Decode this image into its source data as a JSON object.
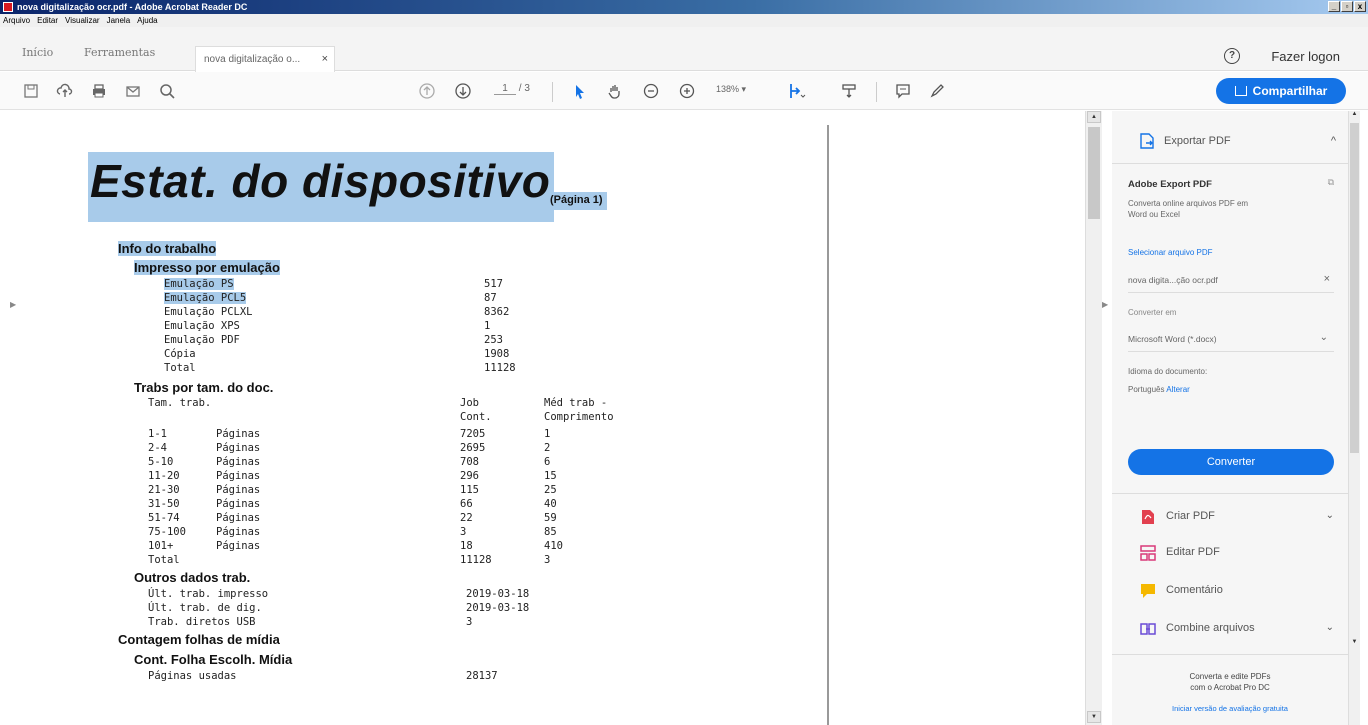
{
  "window": {
    "title": "nova digitalização ocr.pdf - Adobe Acrobat Reader DC",
    "controls": [
      "_",
      "▫",
      "x"
    ]
  },
  "menu": [
    "Arquivo",
    "Editar",
    "Visualizar",
    "Janela",
    "Ajuda"
  ],
  "tabs": {
    "home": "Início",
    "tools": "Ferramentas",
    "doc": "nova digitalização o...",
    "doc_close": "×"
  },
  "header": {
    "help": "?",
    "login": "Fazer logon"
  },
  "toolbar": {
    "page_current": "1",
    "page_total": "/ 3",
    "zoom": "138% ▾",
    "share": "Compartilhar"
  },
  "document": {
    "title": "Estat. do dispositivo",
    "title_sub": "(Página 1)",
    "s_info": "Info do trabalho",
    "s_emul": "Impresso por emulação",
    "emulation": [
      {
        "label": "Emulação PS",
        "value": "517"
      },
      {
        "label": "Emulação PCL5",
        "value": "87"
      },
      {
        "label": "Emulação PCLXL",
        "value": "8362"
      },
      {
        "label": "Emulação XPS",
        "value": "1"
      },
      {
        "label": "Emulação PDF",
        "value": "253"
      },
      {
        "label": "Cópia",
        "value": "1908"
      },
      {
        "label": "Total",
        "value": "11128"
      }
    ],
    "s_size": "Trabs por tam. do doc.",
    "size_head": {
      "c1": "Tam. trab.",
      "c2a": "Job",
      "c2b": "Cont.",
      "c3a": "Méd trab -",
      "c3b": "Comprimento"
    },
    "size_rows": [
      {
        "range": "1-1",
        "unit": "Páginas",
        "count": "7205",
        "avg": "1"
      },
      {
        "range": "2-4",
        "unit": "Páginas",
        "count": "2695",
        "avg": "2"
      },
      {
        "range": "5-10",
        "unit": "Páginas",
        "count": "708",
        "avg": "6"
      },
      {
        "range": "11-20",
        "unit": "Páginas",
        "count": "296",
        "avg": "15"
      },
      {
        "range": "21-30",
        "unit": "Páginas",
        "count": "115",
        "avg": "25"
      },
      {
        "range": "31-50",
        "unit": "Páginas",
        "count": "66",
        "avg": "40"
      },
      {
        "range": "51-74",
        "unit": "Páginas",
        "count": "22",
        "avg": "59"
      },
      {
        "range": "75-100",
        "unit": "Páginas",
        "count": "3",
        "avg": "85"
      },
      {
        "range": "101+",
        "unit": "Páginas",
        "count": "18",
        "avg": "410"
      },
      {
        "range": "Total",
        "unit": "",
        "count": "11128",
        "avg": "3"
      }
    ],
    "s_other": "Outros dados trab.",
    "other": [
      {
        "label": "Últ. trab. impresso",
        "value": "2019-03-18"
      },
      {
        "label": "Últ. trab. de dig.",
        "value": "2019-03-18"
      },
      {
        "label": "Trab. diretos USB",
        "value": "3"
      }
    ],
    "s_media": "Contagem folhas de mídia",
    "s_media_sub": "Cont. Folha Escolh. Mídia",
    "media": [
      {
        "label": "Páginas usadas",
        "value": "28137"
      }
    ]
  },
  "panel": {
    "export_title": "Exportar PDF",
    "export_caret": "^",
    "adobe_export": "Adobe Export PDF",
    "desc1": "Converta online arquivos PDF em",
    "desc2": "Word ou Excel",
    "select_file": "Selecionar arquivo PDF",
    "file_name": "nova digita...ção ocr.pdf",
    "file_remove": "×",
    "convert_to": "Converter em",
    "format": "Microsoft Word (*.docx)",
    "format_caret": "⌄",
    "lang_label": "Idioma do documento:",
    "lang_value": "Português",
    "lang_change": "Alterar",
    "convert_btn": "Converter",
    "tools": [
      {
        "label": "Criar PDF",
        "caret": "⌄"
      },
      {
        "label": "Editar PDF",
        "caret": ""
      },
      {
        "label": "Comentário",
        "caret": ""
      },
      {
        "label": "Combine arquivos",
        "caret": "⌄"
      }
    ],
    "promo1": "Converta e edite PDFs",
    "promo2": "com o Acrobat Pro DC",
    "promo_link": "Iniciar versão de avaliação gratuita"
  },
  "colors": {
    "accent": "#1473e6",
    "highlight": "#a8cbea"
  }
}
